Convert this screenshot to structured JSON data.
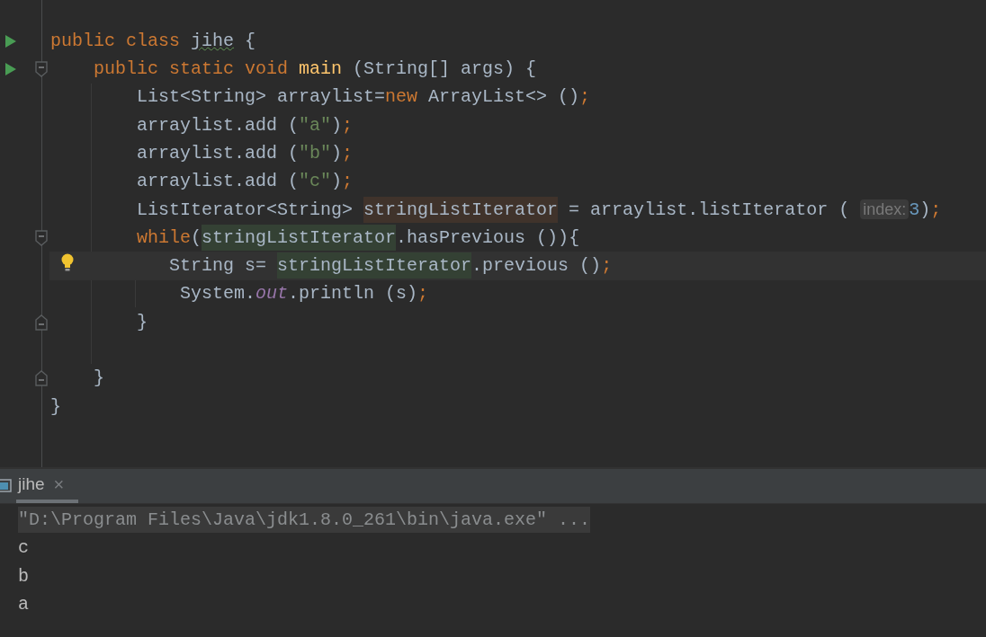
{
  "editor": {
    "lines": [
      {
        "run": true,
        "fold_open": false,
        "fold_close": false,
        "bulb": false,
        "current": false,
        "tokens": [
          {
            "kind": "keyword",
            "text": "public class "
          },
          {
            "kind": "warned_name",
            "text": "jihe"
          },
          {
            "kind": "plain",
            "text": " {"
          }
        ]
      },
      {
        "run": true,
        "fold_open": true,
        "fold_close": false,
        "bulb": false,
        "current": false,
        "tokens": [
          {
            "kind": "keyword",
            "text": "    public static void "
          },
          {
            "kind": "method",
            "text": "main"
          },
          {
            "kind": "plain",
            "text": " (String[] args) {"
          }
        ]
      },
      {
        "run": false,
        "fold_open": false,
        "fold_close": false,
        "bulb": false,
        "current": false,
        "tokens": [
          {
            "kind": "plain",
            "text": "        List<String> arraylist="
          },
          {
            "kind": "keyword",
            "text": "new"
          },
          {
            "kind": "plain",
            "text": " ArrayList<> ()"
          },
          {
            "kind": "keyword",
            "text": ";"
          }
        ]
      },
      {
        "run": false,
        "fold_open": false,
        "fold_close": false,
        "bulb": false,
        "current": false,
        "tokens": [
          {
            "kind": "plain",
            "text": "        arraylist.add ("
          },
          {
            "kind": "string",
            "text": "\"a\""
          },
          {
            "kind": "plain",
            "text": ")"
          },
          {
            "kind": "keyword",
            "text": ";"
          }
        ]
      },
      {
        "run": false,
        "fold_open": false,
        "fold_close": false,
        "bulb": false,
        "current": false,
        "tokens": [
          {
            "kind": "plain",
            "text": "        arraylist.add ("
          },
          {
            "kind": "string",
            "text": "\"b\""
          },
          {
            "kind": "plain",
            "text": ")"
          },
          {
            "kind": "keyword",
            "text": ";"
          }
        ]
      },
      {
        "run": false,
        "fold_open": false,
        "fold_close": false,
        "bulb": false,
        "current": false,
        "tokens": [
          {
            "kind": "plain",
            "text": "        arraylist.add ("
          },
          {
            "kind": "string",
            "text": "\"c\""
          },
          {
            "kind": "plain",
            "text": ")"
          },
          {
            "kind": "keyword",
            "text": ";"
          }
        ]
      },
      {
        "run": false,
        "fold_open": false,
        "fold_close": false,
        "bulb": false,
        "current": false,
        "tokens": [
          {
            "kind": "plain",
            "text": "        ListIterator<String> "
          },
          {
            "kind": "var_write",
            "text": "stringListIterator"
          },
          {
            "kind": "plain",
            "text": " = arraylist.listIterator ( "
          },
          {
            "kind": "hint",
            "text": "index:"
          },
          {
            "kind": "number",
            "text": "3"
          },
          {
            "kind": "plain",
            "text": ")"
          },
          {
            "kind": "keyword",
            "text": ";"
          }
        ]
      },
      {
        "run": false,
        "fold_open": true,
        "fold_close": false,
        "bulb": false,
        "current": false,
        "tokens": [
          {
            "kind": "keyword",
            "text": "        while"
          },
          {
            "kind": "plain",
            "text": "("
          },
          {
            "kind": "var_read",
            "text": "stringListIterator"
          },
          {
            "kind": "plain",
            "text": ".hasPrevious ()){"
          }
        ]
      },
      {
        "run": false,
        "fold_open": false,
        "fold_close": false,
        "bulb": true,
        "current": true,
        "tokens": [
          {
            "kind": "plain",
            "text": "           String s= "
          },
          {
            "kind": "var_read",
            "text": "stringListIterator"
          },
          {
            "kind": "plain",
            "text": ".previous ()"
          },
          {
            "kind": "keyword",
            "text": ";"
          }
        ]
      },
      {
        "run": false,
        "fold_open": false,
        "fold_close": false,
        "bulb": false,
        "current": false,
        "tokens": [
          {
            "kind": "plain",
            "text": "            System."
          },
          {
            "kind": "field",
            "text": "out"
          },
          {
            "kind": "plain",
            "text": ".println (s)"
          },
          {
            "kind": "keyword",
            "text": ";"
          }
        ]
      },
      {
        "run": false,
        "fold_open": false,
        "fold_close": true,
        "bulb": false,
        "current": false,
        "tokens": [
          {
            "kind": "plain",
            "text": "        }"
          }
        ]
      },
      {
        "run": false,
        "fold_open": false,
        "fold_close": false,
        "bulb": false,
        "current": false
      },
      {
        "run": false,
        "fold_open": false,
        "fold_close": true,
        "bulb": false,
        "current": false,
        "tokens": [
          {
            "kind": "plain",
            "text": "    }"
          }
        ]
      },
      {
        "run": false,
        "fold_open": false,
        "fold_close": false,
        "bulb": false,
        "current": false,
        "tokens": [
          {
            "kind": "plain",
            "text": "}"
          }
        ]
      }
    ]
  },
  "console": {
    "tabs": [
      {
        "label": "jihe",
        "close": "×",
        "selected": true
      }
    ],
    "lines": [
      {
        "kind": "command",
        "text": "\"D:\\Program Files\\Java\\jdk1.8.0_261\\bin\\java.exe\" ..."
      },
      {
        "kind": "output",
        "text": "c"
      },
      {
        "kind": "output",
        "text": "b"
      },
      {
        "kind": "output",
        "text": "a"
      }
    ]
  }
}
